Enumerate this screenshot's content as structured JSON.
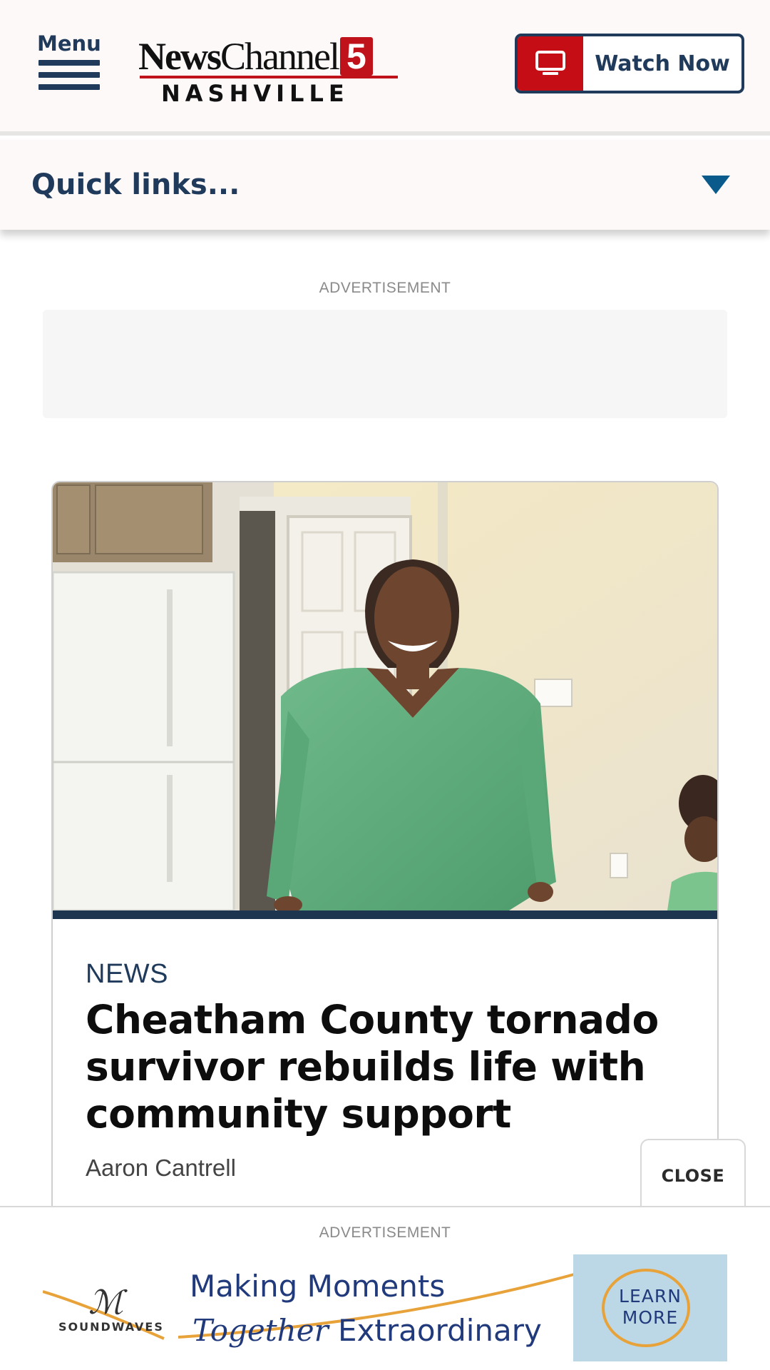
{
  "header": {
    "menu_label": "Menu",
    "logo": {
      "part1": "News",
      "part2": "Channel",
      "number": "5",
      "city": "NASHVILLE"
    },
    "watch_now_label": "Watch Now"
  },
  "quick_links": {
    "label": "Quick links..."
  },
  "ad_top": {
    "label": "ADVERTISEMENT"
  },
  "article": {
    "category": "NEWS",
    "headline": "Cheatham County tornado survivor rebuilds life with community support",
    "author": "Aaron Cantrell"
  },
  "sticky_ad": {
    "close_label": "CLOSE",
    "label": "ADVERTISEMENT",
    "brand": "SOUNDWAVES",
    "line1": "Making Moments",
    "line2_italic": "Together",
    "line2_rest": "Extraordinary",
    "cta": "LEARN MORE"
  },
  "colors": {
    "navy": "#1f3a5a",
    "brand_red": "#c40d14",
    "caret_blue": "#0a5a8c",
    "ad_blue": "#213a7c"
  }
}
